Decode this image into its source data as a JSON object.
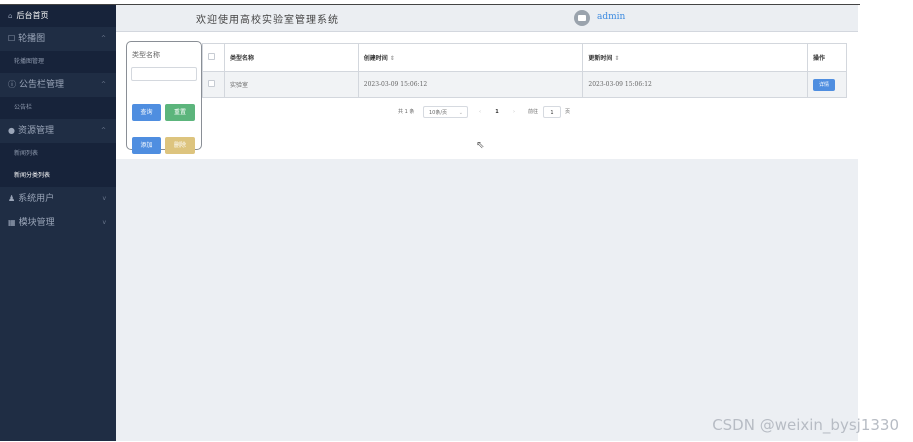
{
  "sidebar": {
    "home": "后台首页",
    "groups": [
      {
        "label": "轮播图",
        "icon": "image-icon",
        "chevron": "^",
        "sub": [
          "轮播图管理"
        ]
      },
      {
        "label": "公告栏管理",
        "icon": "info-circle-icon",
        "chevron": "^",
        "sub": [
          "公告栏"
        ]
      },
      {
        "label": "资源管理",
        "icon": "location-pin-icon",
        "chevron": "^",
        "sub": [
          "新闻列表",
          "新闻分类列表"
        ]
      },
      {
        "label": "系统用户",
        "icon": "user-icon",
        "chevron": "v"
      },
      {
        "label": "模块管理",
        "icon": "grid-icon",
        "chevron": "v"
      }
    ]
  },
  "header": {
    "title": "欢迎使用高校实验室管理系统",
    "user": "admin"
  },
  "search": {
    "label": "类型名称",
    "value": "",
    "query_label": "查询",
    "reset_label": "重置",
    "add_label": "添加",
    "delete_label": "删除"
  },
  "table": {
    "headers": [
      "类型名称",
      "创建时间",
      "更新时间",
      "操作"
    ],
    "rows": [
      {
        "name": "实验室",
        "created": "2023-03-09 15:06:12",
        "updated": "2023-03-09 15:06:12",
        "action": "详情"
      }
    ]
  },
  "pagination": {
    "total": "共 1 条",
    "page_size": "10条/页",
    "current_page": "1",
    "goto_label": "前往",
    "goto_value": "1",
    "page_unit": "页"
  },
  "watermark": "CSDN @weixin_bysj1330"
}
